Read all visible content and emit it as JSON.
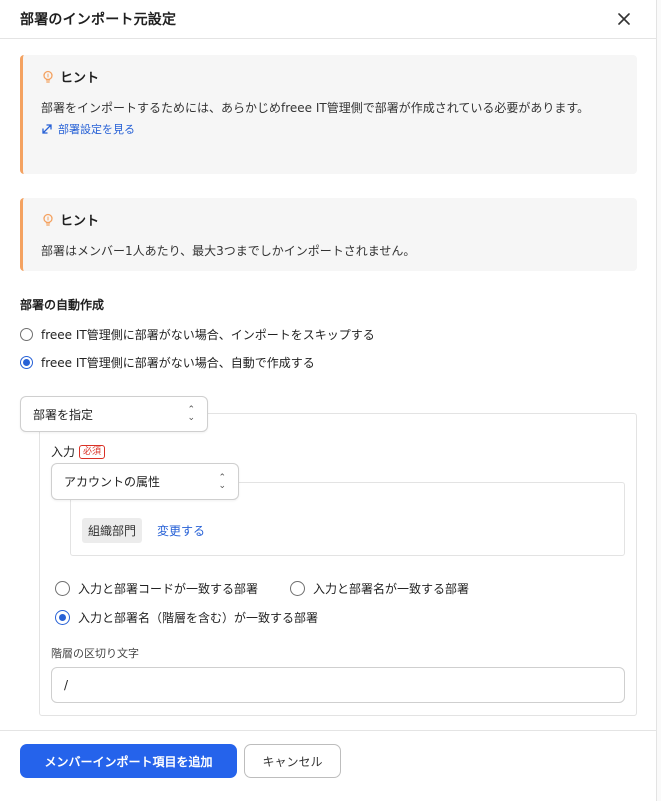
{
  "dialog": {
    "title": "部署のインポート元設定",
    "close_icon": "close-icon"
  },
  "hints": [
    {
      "icon": "lightbulb-icon",
      "heading": "ヒント",
      "text": "部署をインポートするためには、あらかじめfreee IT管理側で部署が作成されている必要があります。",
      "link_icon": "external-link-icon",
      "link_label": "部署設定を見る"
    },
    {
      "icon": "lightbulb-icon",
      "heading": "ヒント",
      "text": "部署はメンバー1人あたり、最大3つまでしかインポートされません。"
    }
  ],
  "auto_create": {
    "title": "部署の自動作成",
    "options": [
      {
        "label": "freee IT管理側に部署がない場合、インポートをスキップする",
        "selected": false
      },
      {
        "label": "freee IT管理側に部署がない場合、自動で作成する",
        "selected": true
      }
    ]
  },
  "department_select": {
    "value": "部署を指定"
  },
  "input": {
    "label": "入力",
    "required_badge": "必須",
    "source_select": {
      "value": "アカウントの属性"
    },
    "attribute_chip": "組織部門",
    "change_label": "変更する"
  },
  "match_options": [
    {
      "label": "入力と部署コードが一致する部署",
      "selected": false
    },
    {
      "label": "入力と部署名が一致する部署",
      "selected": false
    },
    {
      "label": "入力と部署名（階層を含む）が一致する部署",
      "selected": true
    }
  ],
  "delimiter": {
    "label": "階層の区切り文字",
    "value": "/"
  },
  "footer": {
    "primary_label": "メンバーインポート項目を追加",
    "cancel_label": "キャンセル"
  },
  "colors": {
    "accent": "#2563eb",
    "link": "#2761d6",
    "hint_border": "#f4a261",
    "required": "#d93025"
  }
}
